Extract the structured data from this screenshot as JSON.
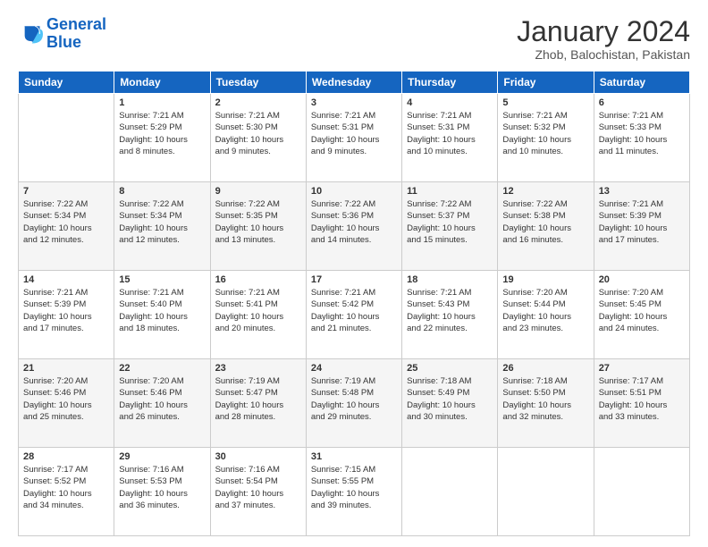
{
  "logo": {
    "line1": "General",
    "line2": "Blue"
  },
  "header": {
    "month": "January 2024",
    "location": "Zhob, Balochistan, Pakistan"
  },
  "weekdays": [
    "Sunday",
    "Monday",
    "Tuesday",
    "Wednesday",
    "Thursday",
    "Friday",
    "Saturday"
  ],
  "weeks": [
    [
      {
        "day": "",
        "info": ""
      },
      {
        "day": "1",
        "info": "Sunrise: 7:21 AM\nSunset: 5:29 PM\nDaylight: 10 hours\nand 8 minutes."
      },
      {
        "day": "2",
        "info": "Sunrise: 7:21 AM\nSunset: 5:30 PM\nDaylight: 10 hours\nand 9 minutes."
      },
      {
        "day": "3",
        "info": "Sunrise: 7:21 AM\nSunset: 5:31 PM\nDaylight: 10 hours\nand 9 minutes."
      },
      {
        "day": "4",
        "info": "Sunrise: 7:21 AM\nSunset: 5:31 PM\nDaylight: 10 hours\nand 10 minutes."
      },
      {
        "day": "5",
        "info": "Sunrise: 7:21 AM\nSunset: 5:32 PM\nDaylight: 10 hours\nand 10 minutes."
      },
      {
        "day": "6",
        "info": "Sunrise: 7:21 AM\nSunset: 5:33 PM\nDaylight: 10 hours\nand 11 minutes."
      }
    ],
    [
      {
        "day": "7",
        "info": "Sunrise: 7:22 AM\nSunset: 5:34 PM\nDaylight: 10 hours\nand 12 minutes."
      },
      {
        "day": "8",
        "info": "Sunrise: 7:22 AM\nSunset: 5:34 PM\nDaylight: 10 hours\nand 12 minutes."
      },
      {
        "day": "9",
        "info": "Sunrise: 7:22 AM\nSunset: 5:35 PM\nDaylight: 10 hours\nand 13 minutes."
      },
      {
        "day": "10",
        "info": "Sunrise: 7:22 AM\nSunset: 5:36 PM\nDaylight: 10 hours\nand 14 minutes."
      },
      {
        "day": "11",
        "info": "Sunrise: 7:22 AM\nSunset: 5:37 PM\nDaylight: 10 hours\nand 15 minutes."
      },
      {
        "day": "12",
        "info": "Sunrise: 7:22 AM\nSunset: 5:38 PM\nDaylight: 10 hours\nand 16 minutes."
      },
      {
        "day": "13",
        "info": "Sunrise: 7:21 AM\nSunset: 5:39 PM\nDaylight: 10 hours\nand 17 minutes."
      }
    ],
    [
      {
        "day": "14",
        "info": "Sunrise: 7:21 AM\nSunset: 5:39 PM\nDaylight: 10 hours\nand 17 minutes."
      },
      {
        "day": "15",
        "info": "Sunrise: 7:21 AM\nSunset: 5:40 PM\nDaylight: 10 hours\nand 18 minutes."
      },
      {
        "day": "16",
        "info": "Sunrise: 7:21 AM\nSunset: 5:41 PM\nDaylight: 10 hours\nand 20 minutes."
      },
      {
        "day": "17",
        "info": "Sunrise: 7:21 AM\nSunset: 5:42 PM\nDaylight: 10 hours\nand 21 minutes."
      },
      {
        "day": "18",
        "info": "Sunrise: 7:21 AM\nSunset: 5:43 PM\nDaylight: 10 hours\nand 22 minutes."
      },
      {
        "day": "19",
        "info": "Sunrise: 7:20 AM\nSunset: 5:44 PM\nDaylight: 10 hours\nand 23 minutes."
      },
      {
        "day": "20",
        "info": "Sunrise: 7:20 AM\nSunset: 5:45 PM\nDaylight: 10 hours\nand 24 minutes."
      }
    ],
    [
      {
        "day": "21",
        "info": "Sunrise: 7:20 AM\nSunset: 5:46 PM\nDaylight: 10 hours\nand 25 minutes."
      },
      {
        "day": "22",
        "info": "Sunrise: 7:20 AM\nSunset: 5:46 PM\nDaylight: 10 hours\nand 26 minutes."
      },
      {
        "day": "23",
        "info": "Sunrise: 7:19 AM\nSunset: 5:47 PM\nDaylight: 10 hours\nand 28 minutes."
      },
      {
        "day": "24",
        "info": "Sunrise: 7:19 AM\nSunset: 5:48 PM\nDaylight: 10 hours\nand 29 minutes."
      },
      {
        "day": "25",
        "info": "Sunrise: 7:18 AM\nSunset: 5:49 PM\nDaylight: 10 hours\nand 30 minutes."
      },
      {
        "day": "26",
        "info": "Sunrise: 7:18 AM\nSunset: 5:50 PM\nDaylight: 10 hours\nand 32 minutes."
      },
      {
        "day": "27",
        "info": "Sunrise: 7:17 AM\nSunset: 5:51 PM\nDaylight: 10 hours\nand 33 minutes."
      }
    ],
    [
      {
        "day": "28",
        "info": "Sunrise: 7:17 AM\nSunset: 5:52 PM\nDaylight: 10 hours\nand 34 minutes."
      },
      {
        "day": "29",
        "info": "Sunrise: 7:16 AM\nSunset: 5:53 PM\nDaylight: 10 hours\nand 36 minutes."
      },
      {
        "day": "30",
        "info": "Sunrise: 7:16 AM\nSunset: 5:54 PM\nDaylight: 10 hours\nand 37 minutes."
      },
      {
        "day": "31",
        "info": "Sunrise: 7:15 AM\nSunset: 5:55 PM\nDaylight: 10 hours\nand 39 minutes."
      },
      {
        "day": "",
        "info": ""
      },
      {
        "day": "",
        "info": ""
      },
      {
        "day": "",
        "info": ""
      }
    ]
  ]
}
